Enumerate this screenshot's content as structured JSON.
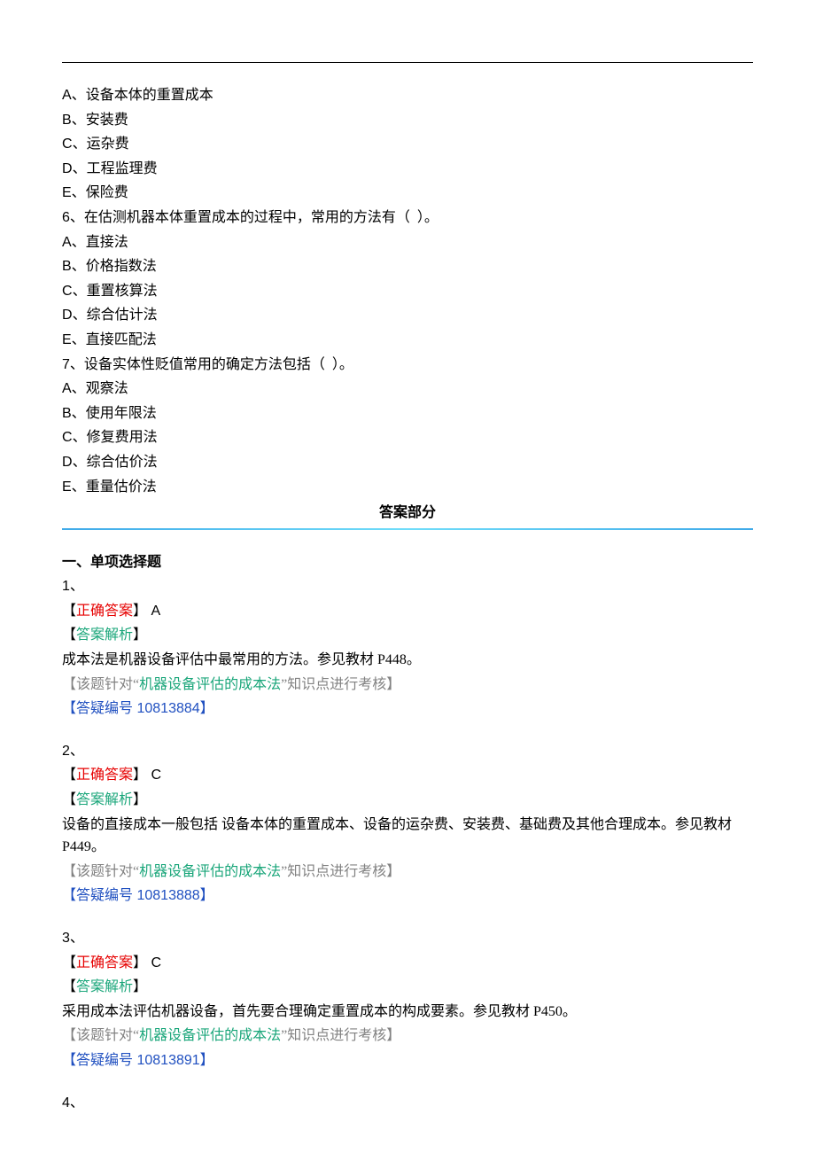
{
  "q5": {
    "options": [
      {
        "letter": "A",
        "text": "设备本体的重置成本"
      },
      {
        "letter": "B",
        "text": "安装费"
      },
      {
        "letter": "C",
        "text": "运杂费"
      },
      {
        "letter": "D",
        "text": "工程监理费"
      },
      {
        "letter": "E",
        "text": "保险费"
      }
    ]
  },
  "q6": {
    "stem_num": "6",
    "stem_text": "在估测机器本体重置成本的过程中，常用的方法有（  ）。",
    "options": [
      {
        "letter": "A",
        "text": "直接法"
      },
      {
        "letter": "B",
        "text": "价格指数法"
      },
      {
        "letter": "C",
        "text": "重置核算法"
      },
      {
        "letter": "D",
        "text": "综合估计法"
      },
      {
        "letter": "E",
        "text": "直接匹配法"
      }
    ]
  },
  "q7": {
    "stem_num": "7",
    "stem_text": "设备实体性贬值常用的确定方法包括（  ）。",
    "options": [
      {
        "letter": "A",
        "text": "观察法"
      },
      {
        "letter": "B",
        "text": "使用年限法"
      },
      {
        "letter": "C",
        "text": "修复费用法"
      },
      {
        "letter": "D",
        "text": "综合估价法"
      },
      {
        "letter": "E",
        "text": "重量估价法"
      }
    ]
  },
  "answer_header": "答案部分",
  "section1_heading": "一、单项选择题",
  "labels": {
    "correct_open": "【",
    "correct_text": "正确答案",
    "correct_close": "】",
    "analysis_open": "【",
    "analysis_text": "答案解析",
    "analysis_close": "】",
    "topic_open": "【",
    "topic_prefix": "该题针对“",
    "topic_green": "机器设备评估的成本法",
    "topic_suffix": "”知识点进行考核",
    "topic_close": "】",
    "faq_open": "【",
    "faq_label": "答疑编号",
    "faq_close": "】"
  },
  "answers": [
    {
      "num": "1、",
      "correct": " A",
      "analysis": "成本法是机器设备评估中最常用的方法。参见教材 P448。",
      "faq": " 10813884"
    },
    {
      "num": "2、",
      "correct": " C",
      "analysis": "设备的直接成本一般包括 设备本体的重置成本、设备的运杂费、安装费、基础费及其他合理成本。参见教材 P449。",
      "faq": " 10813888"
    },
    {
      "num": "3、",
      "correct": " C",
      "analysis": "采用成本法评估机器设备，首先要合理确定重置成本的构成要素。参见教材 P450。",
      "faq": " 10813891"
    }
  ],
  "trailing_num": "4、"
}
